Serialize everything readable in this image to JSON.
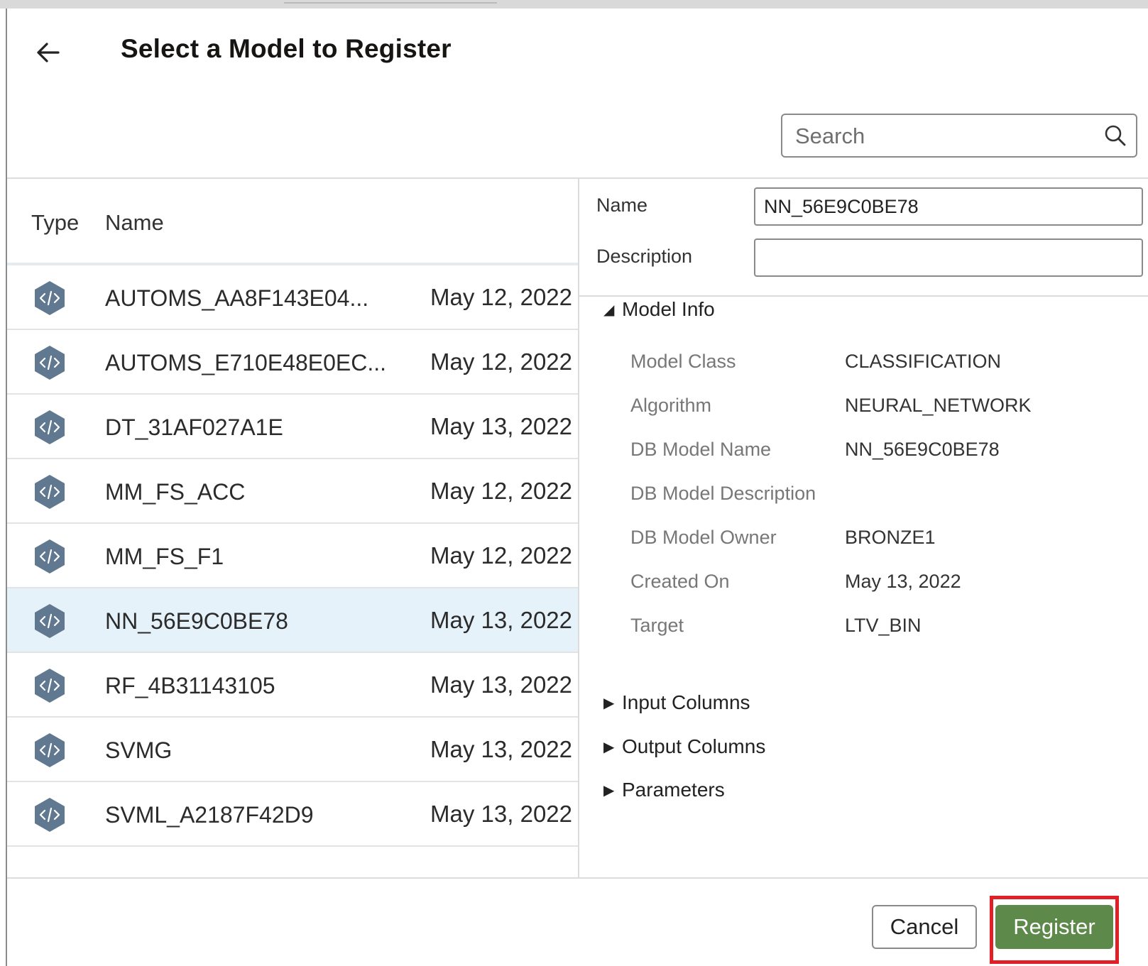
{
  "dialog": {
    "title": "Select a Model to Register"
  },
  "search": {
    "placeholder": "Search"
  },
  "table": {
    "headers": {
      "type": "Type",
      "name": "Name"
    },
    "rows": [
      {
        "name": "AUTOMS_AA8F143E04...",
        "date": "May 12, 2022",
        "selected": false
      },
      {
        "name": "AUTOMS_E710E48E0EC...",
        "date": "May 12, 2022",
        "selected": false
      },
      {
        "name": "DT_31AF027A1E",
        "date": "May 13, 2022",
        "selected": false
      },
      {
        "name": "MM_FS_ACC",
        "date": "May 12, 2022",
        "selected": false
      },
      {
        "name": "MM_FS_F1",
        "date": "May 12, 2022",
        "selected": false
      },
      {
        "name": "NN_56E9C0BE78",
        "date": "May 13, 2022",
        "selected": true
      },
      {
        "name": "RF_4B31143105",
        "date": "May 13, 2022",
        "selected": false
      },
      {
        "name": "SVMG",
        "date": "May 13, 2022",
        "selected": false
      },
      {
        "name": "SVML_A2187F42D9",
        "date": "May 13, 2022",
        "selected": false
      }
    ]
  },
  "details": {
    "name_label": "Name",
    "name_value": "NN_56E9C0BE78",
    "description_label": "Description",
    "description_value": "",
    "model_info": {
      "title": "Model Info",
      "items": [
        {
          "key": "Model Class",
          "value": "CLASSIFICATION"
        },
        {
          "key": "Algorithm",
          "value": "NEURAL_NETWORK"
        },
        {
          "key": "DB Model Name",
          "value": "NN_56E9C0BE78"
        },
        {
          "key": "DB Model Description",
          "value": ""
        },
        {
          "key": "DB Model Owner",
          "value": "BRONZE1"
        },
        {
          "key": "Created On",
          "value": "May 13, 2022"
        },
        {
          "key": "Target",
          "value": "LTV_BIN"
        }
      ]
    },
    "input_columns": "Input Columns",
    "output_columns": "Output Columns",
    "parameters": "Parameters"
  },
  "footer": {
    "cancel_label": "Cancel",
    "register_label": "Register"
  },
  "icons": {
    "back": "arrow-left-icon",
    "search": "search-icon",
    "model_type": "code-hexagon-icon"
  },
  "colors": {
    "selected_row": "#e6f2fa",
    "register_button": "#5d8a4a",
    "highlight_border": "#e01f26",
    "model_icon": "#607890"
  }
}
